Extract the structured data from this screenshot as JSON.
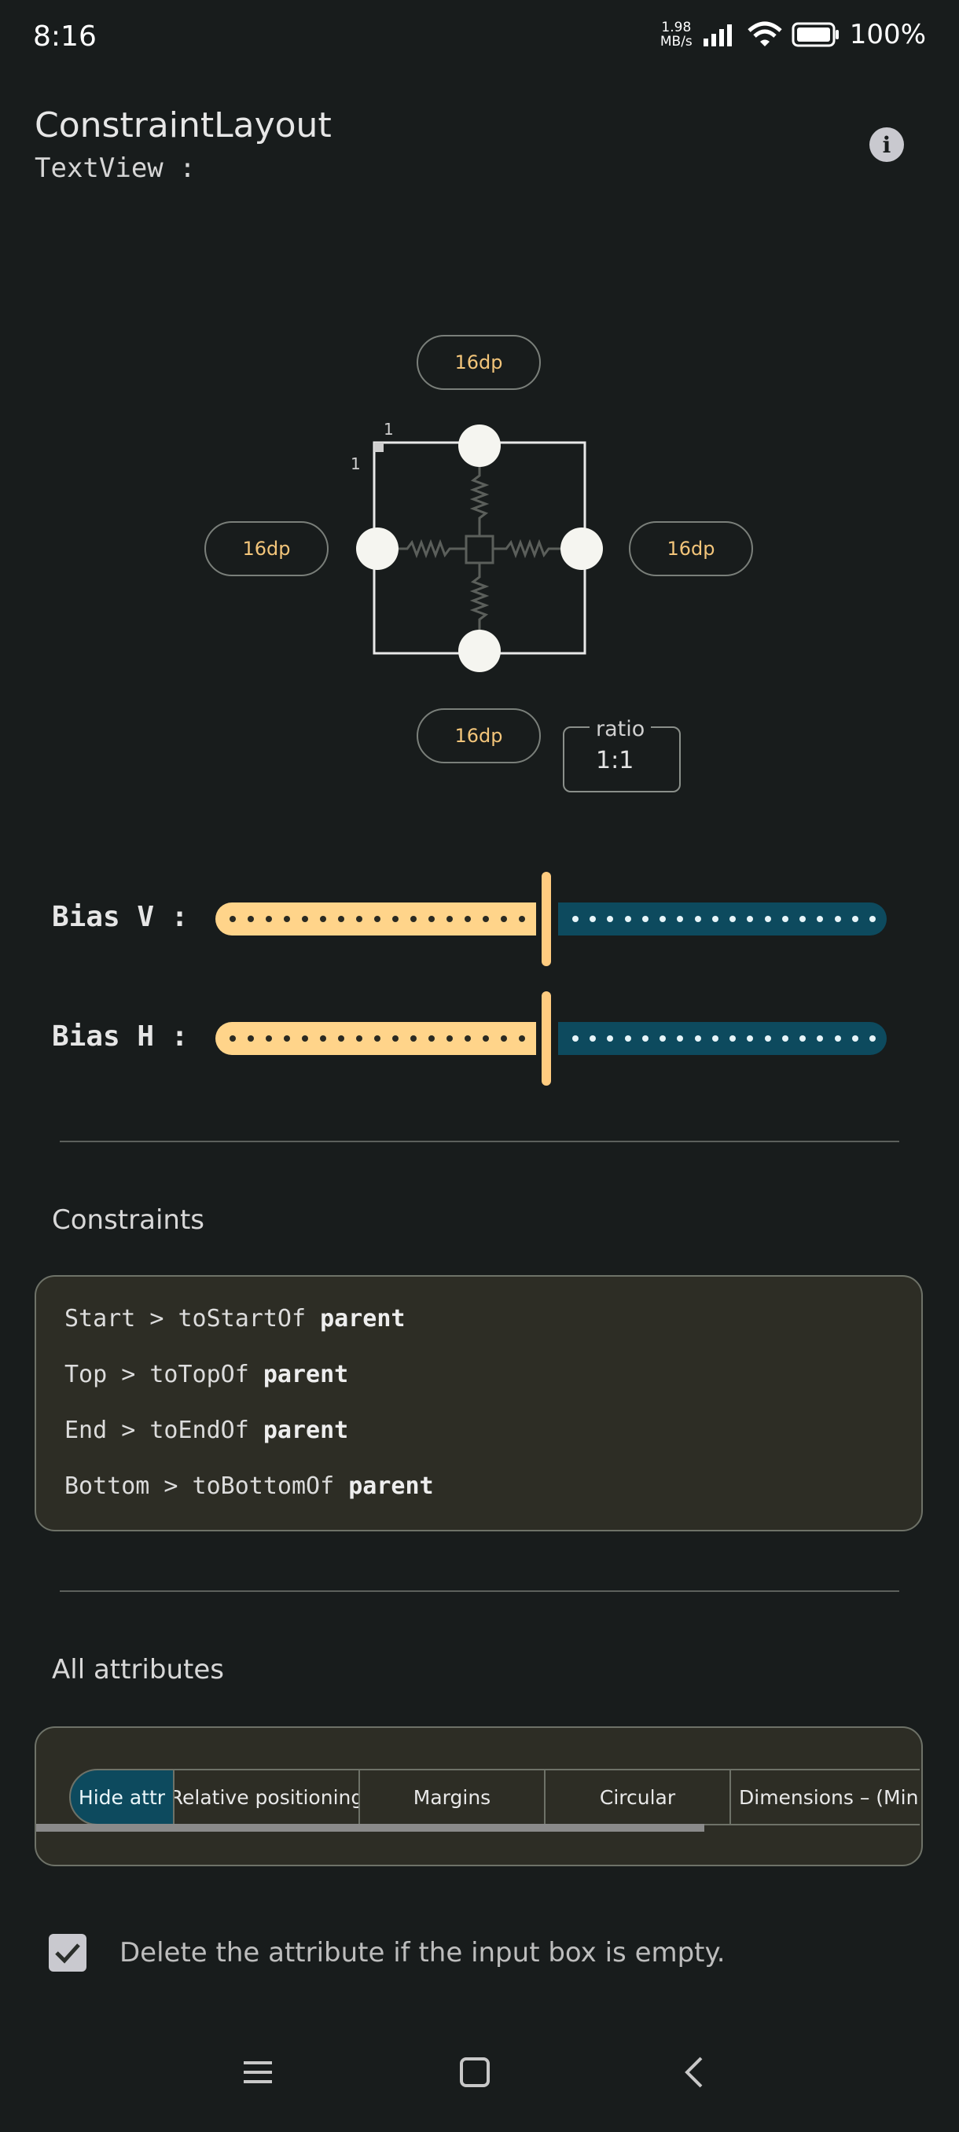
{
  "status_bar": {
    "time": "8:16",
    "net_speed_value": "1.98",
    "net_speed_unit": "MB/s",
    "battery_percent": "100%"
  },
  "header": {
    "title": "ConstraintLayout",
    "subtitle": "TextView :",
    "info_icon": "info-icon"
  },
  "editor": {
    "margin_top": "16dp",
    "margin_start": "16dp",
    "margin_end": "16dp",
    "margin_bottom": "16dp",
    "corner_tick_top": "1",
    "corner_tick_left": "1",
    "ratio_label": "ratio",
    "ratio_value": "1:1"
  },
  "bias": {
    "v_label": "Bias V :",
    "h_label": "Bias H :",
    "v_value": 0.5,
    "h_value": 0.5,
    "colors": {
      "left": "#ffd48a",
      "right": "#0d4a5e",
      "thumb": "#ffcc80"
    }
  },
  "constraints": {
    "title": "Constraints",
    "items": [
      {
        "rule": "Start > toStartOf",
        "target": "parent"
      },
      {
        "rule": "Top > toTopOf",
        "target": "parent"
      },
      {
        "rule": "End > toEndOf",
        "target": "parent"
      },
      {
        "rule": "Bottom > toBottomOf",
        "target": "parent"
      }
    ]
  },
  "attributes": {
    "title": "All attributes",
    "tabs": [
      "Hide attr",
      "Relative positioning",
      "Margins",
      "Circular",
      "Dimensions – (Min an"
    ]
  },
  "delete_option": {
    "label": "Delete the attribute if the input box is empty.",
    "checked": true
  },
  "nav": {
    "icons": [
      "menu-icon",
      "home-icon",
      "back-icon"
    ]
  }
}
